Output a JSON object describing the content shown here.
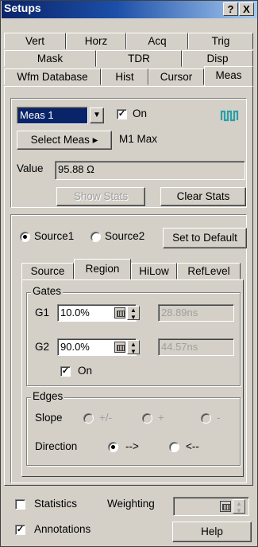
{
  "window": {
    "title": "Setups",
    "help_btn": "?",
    "close_btn": "X"
  },
  "tabs_row1": [
    "Vert",
    "Horz",
    "Acq",
    "Trig"
  ],
  "tabs_row2": [
    "Mask",
    "TDR",
    "Disp"
  ],
  "tabs_row3": [
    "Wfm Database",
    "Hist",
    "Cursor",
    "Meas"
  ],
  "meas": {
    "select_value": "Meas 1",
    "on_label": "On",
    "on_checked": true,
    "select_meas_button": "Select Meas ▸",
    "meas_name": "M1 Max",
    "value_label": "Value",
    "value_text": "95.88 Ω",
    "show_stats_button": "Show Stats",
    "clear_stats_button": "Clear Stats"
  },
  "source": {
    "source1_label": "Source1",
    "source2_label": "Source2",
    "set_default_button": "Set to Default",
    "selected": "Source1"
  },
  "subtabs": [
    "Source",
    "Region",
    "HiLow",
    "RefLevel"
  ],
  "gates": {
    "legend": "Gates",
    "g1_label": "G1",
    "g1_value": "10.0%",
    "g1_time": "28.89ns",
    "g2_label": "G2",
    "g2_value": "90.0%",
    "g2_time": "44.57ns",
    "on_label": "On",
    "on_checked": true
  },
  "edges": {
    "legend": "Edges",
    "slope_label": "Slope",
    "slope_options": [
      "+/-",
      "+",
      "-"
    ],
    "direction_label": "Direction",
    "direction_forward": "-->",
    "direction_back": "<--",
    "direction_selected": "-->"
  },
  "bottom": {
    "statistics_label": "Statistics",
    "statistics_checked": false,
    "weighting_label": "Weighting",
    "annotations_label": "Annotations",
    "annotations_checked": true,
    "help_button": "Help"
  },
  "colors": {
    "title_start": "#0a246a",
    "title_end": "#a6caf0",
    "face": "#d4d0c8",
    "waveform_icon": "#2aa0a8"
  }
}
